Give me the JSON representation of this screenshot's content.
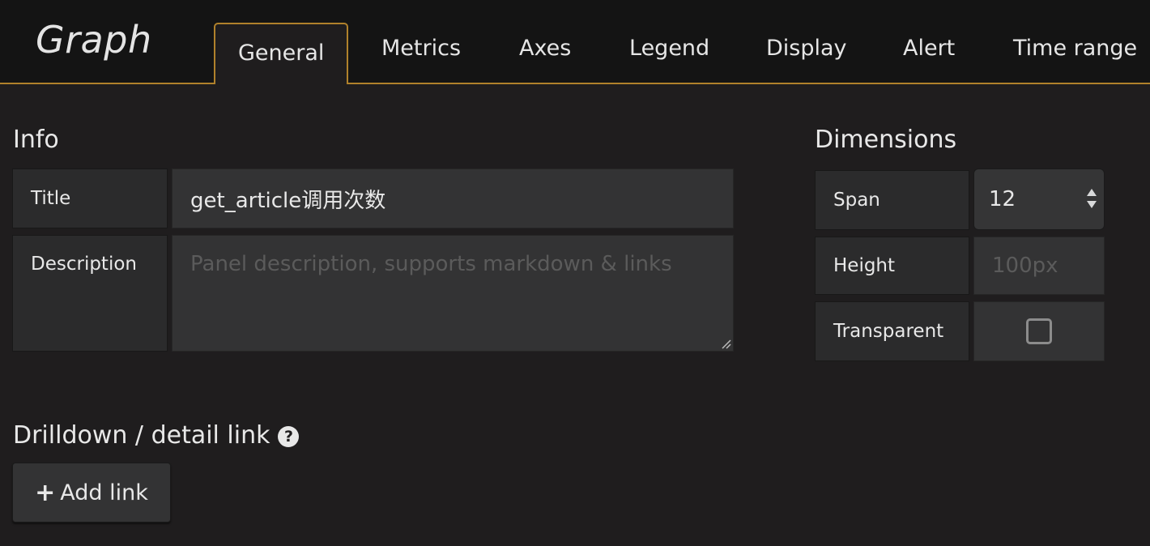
{
  "panel": {
    "type_title": "Graph"
  },
  "tabs": [
    {
      "label": "General",
      "active": true
    },
    {
      "label": "Metrics"
    },
    {
      "label": "Axes"
    },
    {
      "label": "Legend"
    },
    {
      "label": "Display"
    },
    {
      "label": "Alert"
    },
    {
      "label": "Time range"
    }
  ],
  "info": {
    "heading": "Info",
    "title_label": "Title",
    "title_value": "get_article调用次数",
    "description_label": "Description",
    "description_placeholder": "Panel description, supports markdown & links"
  },
  "dimensions": {
    "heading": "Dimensions",
    "span_label": "Span",
    "span_value": "12",
    "height_label": "Height",
    "height_placeholder": "100px",
    "transparent_label": "Transparent",
    "transparent_checked": false
  },
  "drilldown": {
    "heading": "Drilldown / detail link",
    "help_icon": "question-circle-icon",
    "add_link_label": "Add link",
    "add_link_icon": "plus-icon"
  },
  "colors": {
    "accent": "#b0812b",
    "background": "#1f1d1e",
    "header_bg": "#141414"
  }
}
